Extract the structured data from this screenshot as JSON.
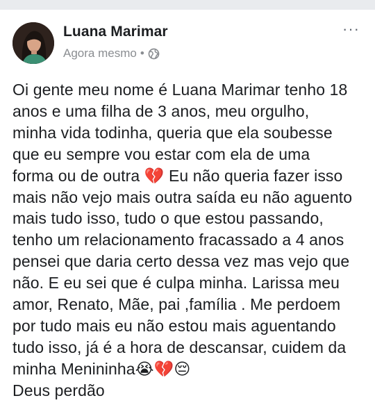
{
  "post": {
    "author": "Luana Marimar",
    "timestamp": "Agora mesmo",
    "separator": "•",
    "privacy_icon": "globe-icon",
    "more_label": "···",
    "text": "Oi gente meu nome é Luana Marimar tenho 18\nanos e uma filha de 3 anos, meu orgulho,\nminha vida todinha, queria que ela soubesse\nque eu sempre vou estar com ela de uma\nforma ou de outra 💔 Eu não queria fazer isso\nmais não vejo mais outra saída eu não aguento\nmais tudo isso, tudo o que estou passando,\ntenho um relacionamento fracassado a 4 anos\npensei que daria certo dessa vez mas vejo que\nnão. E eu sei que é culpa minha. Larissa meu\namor, Renato, Mãe, pai ,família . Me perdoem\npor tudo mais eu não estou mais aguentando\ntudo isso, já é a hora de descansar, cuidem da\nminha Menininha😭💔😔\nDeus perdão"
  },
  "colors": {
    "background": "#ffffff",
    "topbar": "#e9ebee",
    "text": "#1c1e21",
    "meta": "#8a8d91"
  }
}
